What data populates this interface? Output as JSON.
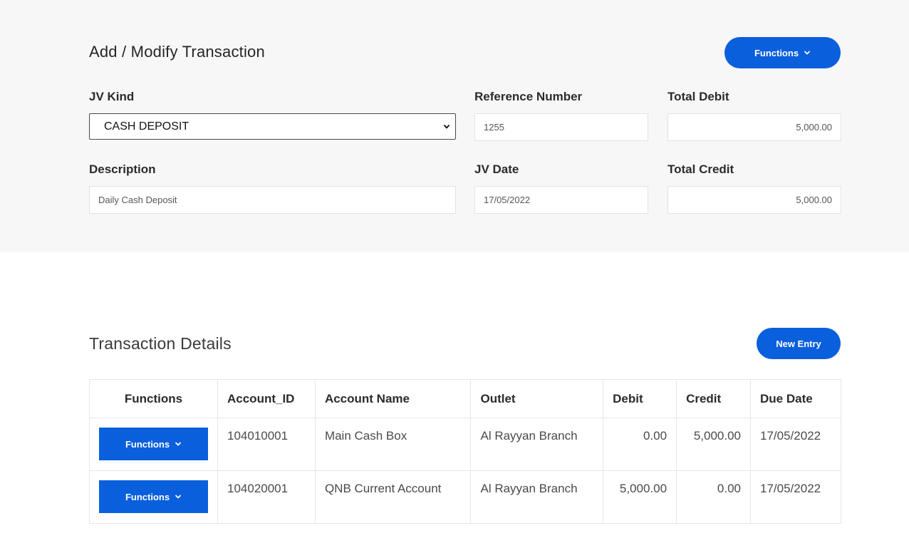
{
  "header": {
    "title": "Add / Modify Transaction",
    "functions_label": "Functions"
  },
  "form": {
    "jv_kind": {
      "label": "JV Kind",
      "value": "CASH DEPOSIT"
    },
    "reference_number": {
      "label": "Reference Number",
      "value": "1255"
    },
    "total_debit": {
      "label": "Total Debit",
      "value": "5,000.00"
    },
    "description": {
      "label": "Description",
      "value": "Daily Cash Deposit"
    },
    "jv_date": {
      "label": "JV Date",
      "value": "17/05/2022"
    },
    "total_credit": {
      "label": "Total Credit",
      "value": "5,000.00"
    }
  },
  "details": {
    "title": "Transaction Details",
    "new_entry_label": "New Entry",
    "columns": [
      "Functions",
      "Account_ID",
      "Account Name",
      "Outlet",
      "Debit",
      "Credit",
      "Due Date"
    ],
    "rows": [
      {
        "functions_label": "Functions",
        "account_id": "104010001",
        "account_name": "Main Cash Box",
        "outlet": "Al Rayyan Branch",
        "debit": "0.00",
        "credit": "5,000.00",
        "due_date": "17/05/2022"
      },
      {
        "functions_label": "Functions",
        "account_id": "104020001",
        "account_name": "QNB Current Account",
        "outlet": "Al Rayyan Branch",
        "debit": "5,000.00",
        "credit": "0.00",
        "due_date": "17/05/2022"
      }
    ]
  },
  "icons": {
    "dropdown": "chevron-down-icon"
  },
  "colors": {
    "accent": "#0a5fdc",
    "panel_bg": "#f7f7f7"
  }
}
